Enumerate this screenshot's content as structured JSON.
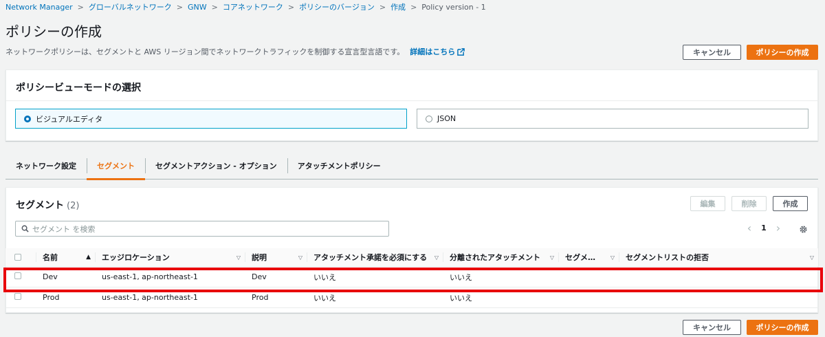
{
  "breadcrumb": {
    "items": [
      "Network Manager",
      "グローバルネットワーク",
      "GNW",
      "コアネットワーク",
      "ポリシーのバージョン",
      "作成"
    ],
    "current": "Policy version - 1"
  },
  "page": {
    "title": "ポリシーの作成",
    "description": "ネットワークポリシーは、セグメントと AWS リージョン間でネットワークトラフィックを制御する宣言型言語です。",
    "learn_more": "詳細はこちら"
  },
  "header_buttons": {
    "cancel": "キャンセル",
    "create": "ポリシーの作成"
  },
  "view_mode": {
    "title": "ポリシービューモードの選択",
    "options": [
      {
        "label": "ビジュアルエディタ",
        "selected": true
      },
      {
        "label": "JSON",
        "selected": false
      }
    ]
  },
  "tabs": [
    {
      "label": "ネットワーク設定",
      "active": false
    },
    {
      "label": "セグメント",
      "active": true
    },
    {
      "label": "セグメントアクション - オプション",
      "active": false
    },
    {
      "label": "アタッチメントポリシー",
      "active": false
    }
  ],
  "segments": {
    "title": "セグメント",
    "count": "(2)",
    "actions": {
      "edit": "編集",
      "delete": "削除",
      "create": "作成"
    },
    "search_placeholder": "セグメント を検索",
    "pagination": {
      "prev": "‹",
      "page": "1",
      "next": "›"
    },
    "columns": [
      "名前",
      "エッジロケーション",
      "説明",
      "アタッチメント承諾を必須にする",
      "分離されたアタッチメント",
      "セグメ…",
      "セグメントリストの拒否"
    ],
    "rows": [
      {
        "name": "Dev",
        "edge": "us-east-1, ap-northeast-1",
        "desc": "Dev",
        "require_accept": "いいえ",
        "isolated": "いいえ",
        "segm": "",
        "deny": ""
      },
      {
        "name": "Prod",
        "edge": "us-east-1, ap-northeast-1",
        "desc": "Prod",
        "require_accept": "いいえ",
        "isolated": "いいえ",
        "segm": "",
        "deny": ""
      }
    ]
  },
  "footer_buttons": {
    "cancel": "キャンセル",
    "create": "ポリシーの作成"
  },
  "colors": {
    "accent": "#ec7211",
    "link": "#0073bb",
    "highlight": "#e8000b"
  }
}
